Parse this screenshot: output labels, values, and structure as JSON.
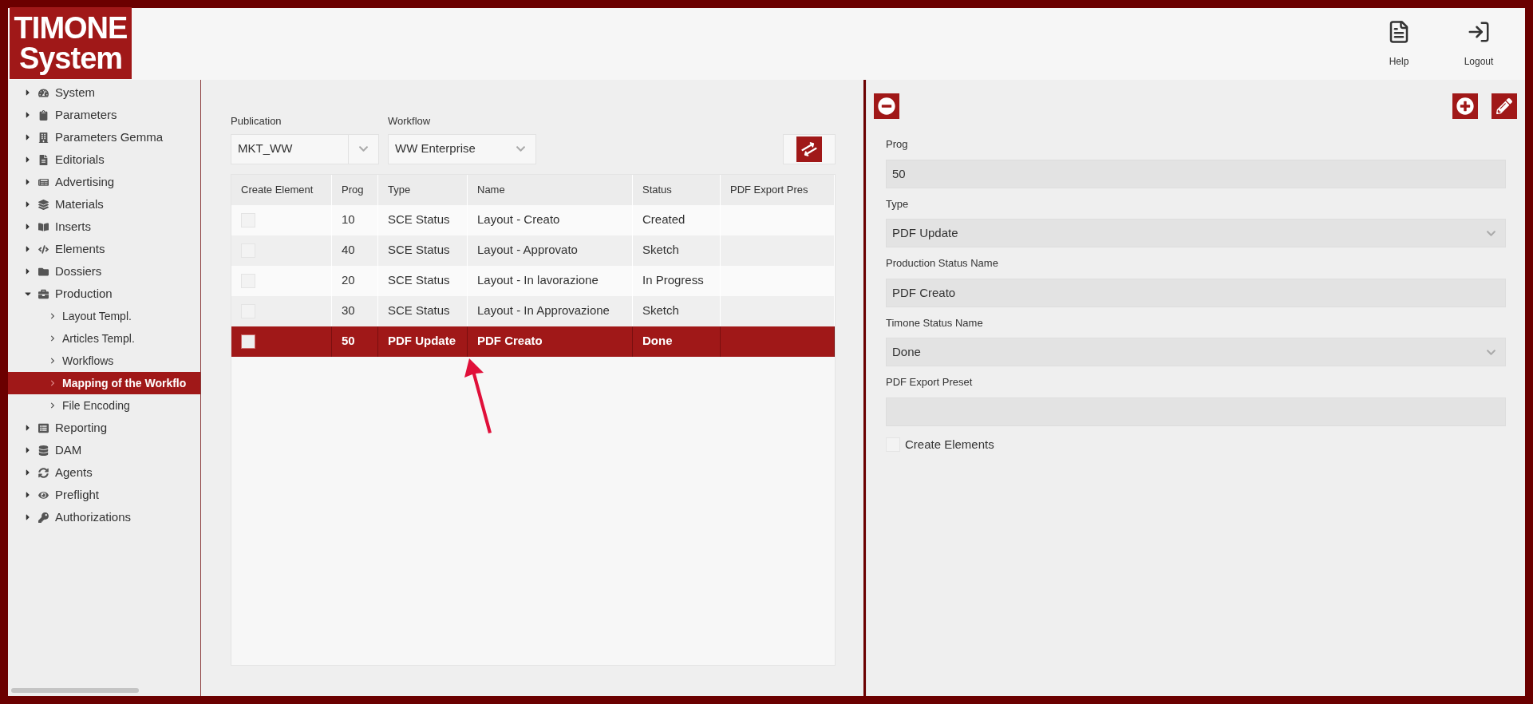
{
  "logo": {
    "line1": "TIMONE",
    "line2": "System"
  },
  "header_actions": [
    {
      "label": "Help"
    },
    {
      "label": "Logout"
    }
  ],
  "sidebar": {
    "items": [
      {
        "label": "System",
        "expanded": false,
        "selected": false
      },
      {
        "label": "Parameters",
        "expanded": false,
        "selected": false
      },
      {
        "label": "Parameters Gemma",
        "expanded": false,
        "selected": false
      },
      {
        "label": "Editorials",
        "expanded": false,
        "selected": false
      },
      {
        "label": "Advertising",
        "expanded": false,
        "selected": false
      },
      {
        "label": "Materials",
        "expanded": false,
        "selected": false
      },
      {
        "label": "Inserts",
        "expanded": false,
        "selected": false
      },
      {
        "label": "Elements",
        "expanded": false,
        "selected": false
      },
      {
        "label": "Dossiers",
        "expanded": false,
        "selected": false
      },
      {
        "label": "Production",
        "expanded": true,
        "selected": false,
        "children": [
          {
            "label": "Layout Templ.",
            "selected": false
          },
          {
            "label": "Articles Templ.",
            "selected": false
          },
          {
            "label": "Workflows",
            "selected": false
          },
          {
            "label": "Mapping of the Workflo",
            "selected": true
          },
          {
            "label": "File Encoding",
            "selected": false
          }
        ]
      },
      {
        "label": "Reporting",
        "expanded": false,
        "selected": false
      },
      {
        "label": "DAM",
        "expanded": false,
        "selected": false
      },
      {
        "label": "Agents",
        "expanded": false,
        "selected": false
      },
      {
        "label": "Preflight",
        "expanded": false,
        "selected": false
      },
      {
        "label": "Authorizations",
        "expanded": false,
        "selected": false
      }
    ]
  },
  "filters": [
    {
      "label": "Publication",
      "value": "MKT_WW"
    },
    {
      "label": "Workflow",
      "value": "WW Enterprise"
    }
  ],
  "table": {
    "columns": [
      "Create Element",
      "Prog",
      "Type",
      "Name",
      "Status",
      "PDF Export Pres"
    ],
    "rows": [
      {
        "checked": false,
        "selected": false,
        "cells": [
          "",
          "10",
          "SCE Status",
          "Layout - Creato",
          "Created",
          ""
        ]
      },
      {
        "checked": false,
        "selected": false,
        "cells": [
          "",
          "40",
          "SCE Status",
          "Layout - Approvato",
          "Sketch",
          ""
        ]
      },
      {
        "checked": false,
        "selected": false,
        "cells": [
          "",
          "20",
          "SCE Status",
          "Layout - In lavorazione",
          "In Progress",
          ""
        ]
      },
      {
        "checked": false,
        "selected": false,
        "cells": [
          "",
          "30",
          "SCE Status",
          "Layout - In Approvazione",
          "Sketch",
          ""
        ]
      },
      {
        "checked": false,
        "selected": true,
        "cells": [
          "",
          "50",
          "PDF Update",
          "PDF Creato",
          "Done",
          ""
        ]
      }
    ]
  },
  "form": {
    "fields": [
      {
        "kind": "text",
        "label": "Prog",
        "value": "50"
      },
      {
        "kind": "select",
        "label": "Type",
        "value": "PDF Update"
      },
      {
        "kind": "text",
        "label": "Production Status Name",
        "value": "PDF Creato"
      },
      {
        "kind": "select",
        "label": "Timone Status Name",
        "value": "Done"
      },
      {
        "kind": "text",
        "label": "PDF Export Preset"
      }
    ],
    "checkbox": {
      "label": "Create Elements",
      "checked": false
    }
  }
}
